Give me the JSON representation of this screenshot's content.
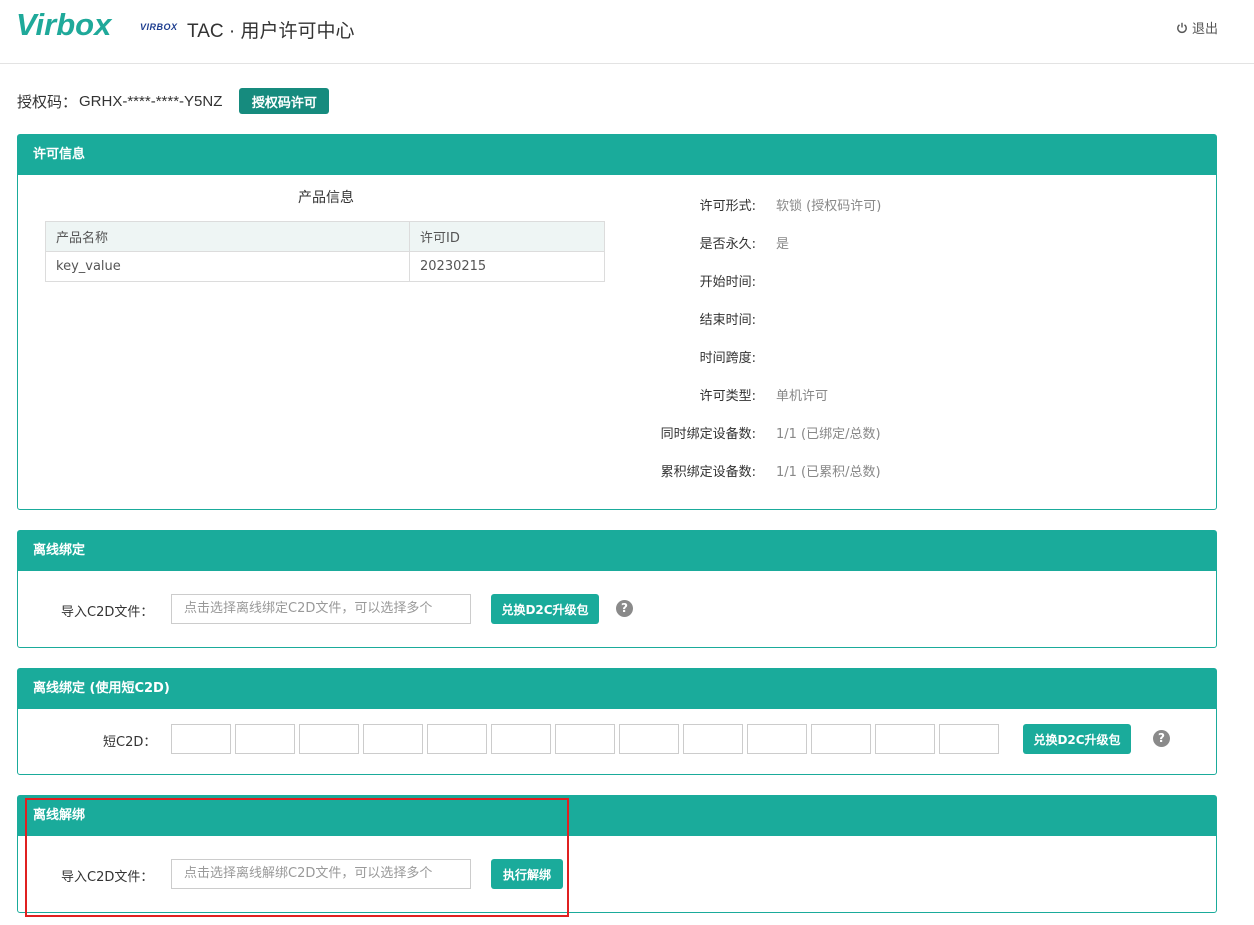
{
  "header": {
    "logo": "Virbox",
    "mini_logo": "VIRBOX",
    "title": "TAC · 用户许可中心",
    "logout": "退出"
  },
  "auth": {
    "label": "授权码：",
    "code": "GRHX-****-****-Y5NZ",
    "button": "授权码许可"
  },
  "license_panel": {
    "title": "许可信息",
    "product_title": "产品信息",
    "columns": [
      "产品名称",
      "许可ID"
    ],
    "rows": [
      [
        "key_value",
        "20230215"
      ]
    ],
    "info": [
      {
        "label": "许可形式:",
        "value": "软锁 (授权码许可)"
      },
      {
        "label": "是否永久:",
        "value": "是"
      },
      {
        "label": "开始时间:",
        "value": ""
      },
      {
        "label": "结束时间:",
        "value": ""
      },
      {
        "label": "时间跨度:",
        "value": ""
      },
      {
        "label": "许可类型:",
        "value": "单机许可"
      },
      {
        "label": "同时绑定设备数:",
        "value": "1/1 (已绑定/总数)"
      },
      {
        "label": "累积绑定设备数:",
        "value": "1/1 (已累积/总数)"
      }
    ]
  },
  "offline_bind": {
    "title": "离线绑定",
    "label": "导入C2D文件：",
    "placeholder": "点击选择离线绑定C2D文件，可以选择多个",
    "button": "兑换D2C升级包"
  },
  "offline_bind_short": {
    "title": "离线绑定 (使用短C2D)",
    "label": "短C2D：",
    "box_count": 13,
    "button": "兑换D2C升级包"
  },
  "offline_unbind": {
    "title": "离线解绑",
    "label": "导入C2D文件：",
    "placeholder": "点击选择离线解绑C2D文件，可以选择多个",
    "button": "执行解绑"
  },
  "help_glyph": "?",
  "colors": {
    "accent": "#1aab9b",
    "highlight": "#e02020"
  }
}
